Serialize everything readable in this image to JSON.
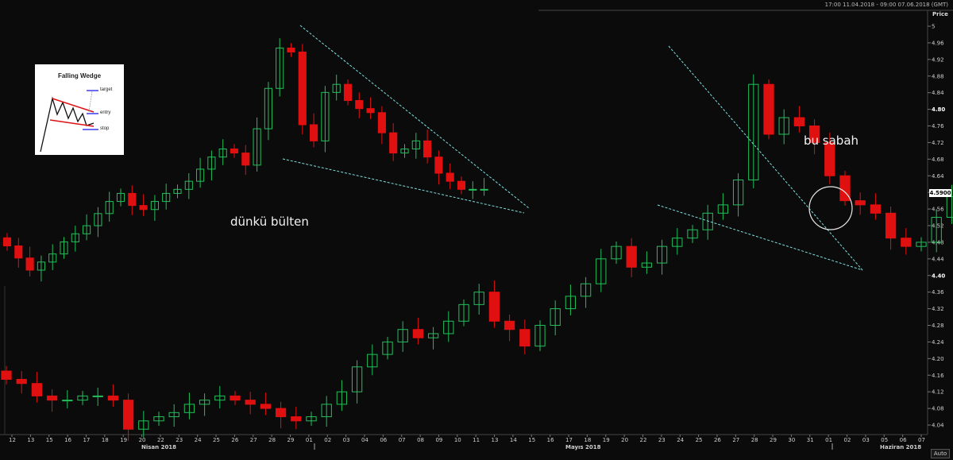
{
  "header": {
    "range": "17:00 11.04.2018 - 09:00 07.06.2018 (GMT)"
  },
  "price_axis": {
    "title": "Price",
    "auto_label": "Auto",
    "last_price_tag": "4.5900"
  },
  "annotations": {
    "left_note": "dünkü bülten",
    "right_note": "bu sabah"
  },
  "inset": {
    "title": "Falling Wedge",
    "labels": {
      "target": "target",
      "entry": "entry",
      "stop": "stop"
    }
  },
  "colors": {
    "up": "#22c05a",
    "down": "#e01010",
    "trend": "#7fe0e0",
    "background": "#0b0b0b"
  },
  "chart_data": [
    {
      "type": "candlestick",
      "title": "dünkü bülten",
      "x_ticks": [
        "12",
        "13",
        "15",
        "16",
        "17",
        "18",
        "19",
        "20",
        "22",
        "23",
        "24",
        "25",
        "26",
        "27",
        "28",
        "29",
        "01",
        "02",
        "03",
        "04",
        "06",
        "07",
        "08",
        "09",
        "10",
        "11",
        "13",
        "14",
        "15"
      ],
      "period_labels": [
        "Nisan 2018",
        "Mayıs 2018"
      ],
      "ylim": [
        4.0,
        5.0
      ],
      "close_series": [
        4.46,
        4.43,
        4.4,
        4.42,
        4.44,
        4.47,
        4.49,
        4.51,
        4.54,
        4.57,
        4.59,
        4.56,
        4.55,
        4.57,
        4.59,
        4.6,
        4.62,
        4.65,
        4.68,
        4.7,
        4.69,
        4.66,
        4.75,
        4.85,
        4.95,
        4.94,
        4.76,
        4.72,
        4.84,
        4.86,
        4.82,
        4.8,
        4.79,
        4.74,
        4.69,
        4.7,
        4.72,
        4.68,
        4.64,
        4.62,
        4.6,
        4.6,
        4.6
      ],
      "trendlines": [
        {
          "name": "upper",
          "points": [
            [
              "29",
              4.99
            ],
            [
              "13",
              4.55
            ]
          ]
        },
        {
          "name": "lower",
          "points": [
            [
              "29",
              4.67
            ],
            [
              "13",
              4.55
            ]
          ]
        }
      ]
    },
    {
      "type": "candlestick",
      "title": "bu sabah",
      "x_ticks": [
        "12",
        "13",
        "15",
        "16",
        "17",
        "18",
        "19",
        "20",
        "22",
        "23",
        "24",
        "25",
        "26",
        "27",
        "28",
        "29",
        "01",
        "02",
        "03",
        "04",
        "06",
        "07",
        "08",
        "09",
        "10",
        "11",
        "13",
        "14",
        "15",
        "16",
        "17",
        "18",
        "19",
        "20",
        "22",
        "23",
        "24",
        "25",
        "26",
        "27",
        "28",
        "29",
        "30",
        "31",
        "01",
        "02",
        "03",
        "05",
        "06",
        "07"
      ],
      "period_labels": [
        "Nisan 2018",
        "Mayıs 2018",
        "Haziran 2018"
      ],
      "y_ticks": [
        4.04,
        4.08,
        4.12,
        4.16,
        4.2,
        4.24,
        4.28,
        4.32,
        4.36,
        4.4,
        4.44,
        4.48,
        4.52,
        4.56,
        4.6,
        4.64,
        4.68,
        4.72,
        4.76,
        4.8,
        4.84,
        4.88,
        4.92,
        4.96,
        5.0
      ],
      "ylim": [
        4.0,
        5.02
      ],
      "close_series": [
        4.15,
        4.14,
        4.11,
        4.1,
        4.1,
        4.11,
        4.11,
        4.1,
        4.03,
        4.05,
        4.06,
        4.07,
        4.09,
        4.1,
        4.11,
        4.1,
        4.09,
        4.08,
        4.06,
        4.05,
        4.06,
        4.09,
        4.12,
        4.18,
        4.21,
        4.24,
        4.27,
        4.25,
        4.26,
        4.29,
        4.33,
        4.36,
        4.29,
        4.27,
        4.23,
        4.28,
        4.32,
        4.35,
        4.38,
        4.44,
        4.47,
        4.42,
        4.43,
        4.47,
        4.49,
        4.51,
        4.55,
        4.57,
        4.63,
        4.86,
        4.74,
        4.78,
        4.76,
        4.72,
        4.64,
        4.58,
        4.57,
        4.55,
        4.49,
        4.47,
        4.48,
        4.54,
        4.59
      ],
      "last_value": 4.59,
      "trendlines": [
        {
          "name": "upper",
          "points": [
            [
              "23",
              4.96
            ],
            [
              "03",
              4.41
            ]
          ]
        },
        {
          "name": "lower",
          "points": [
            [
              "22",
              4.57
            ],
            [
              "03",
              4.41
            ]
          ]
        }
      ]
    }
  ]
}
